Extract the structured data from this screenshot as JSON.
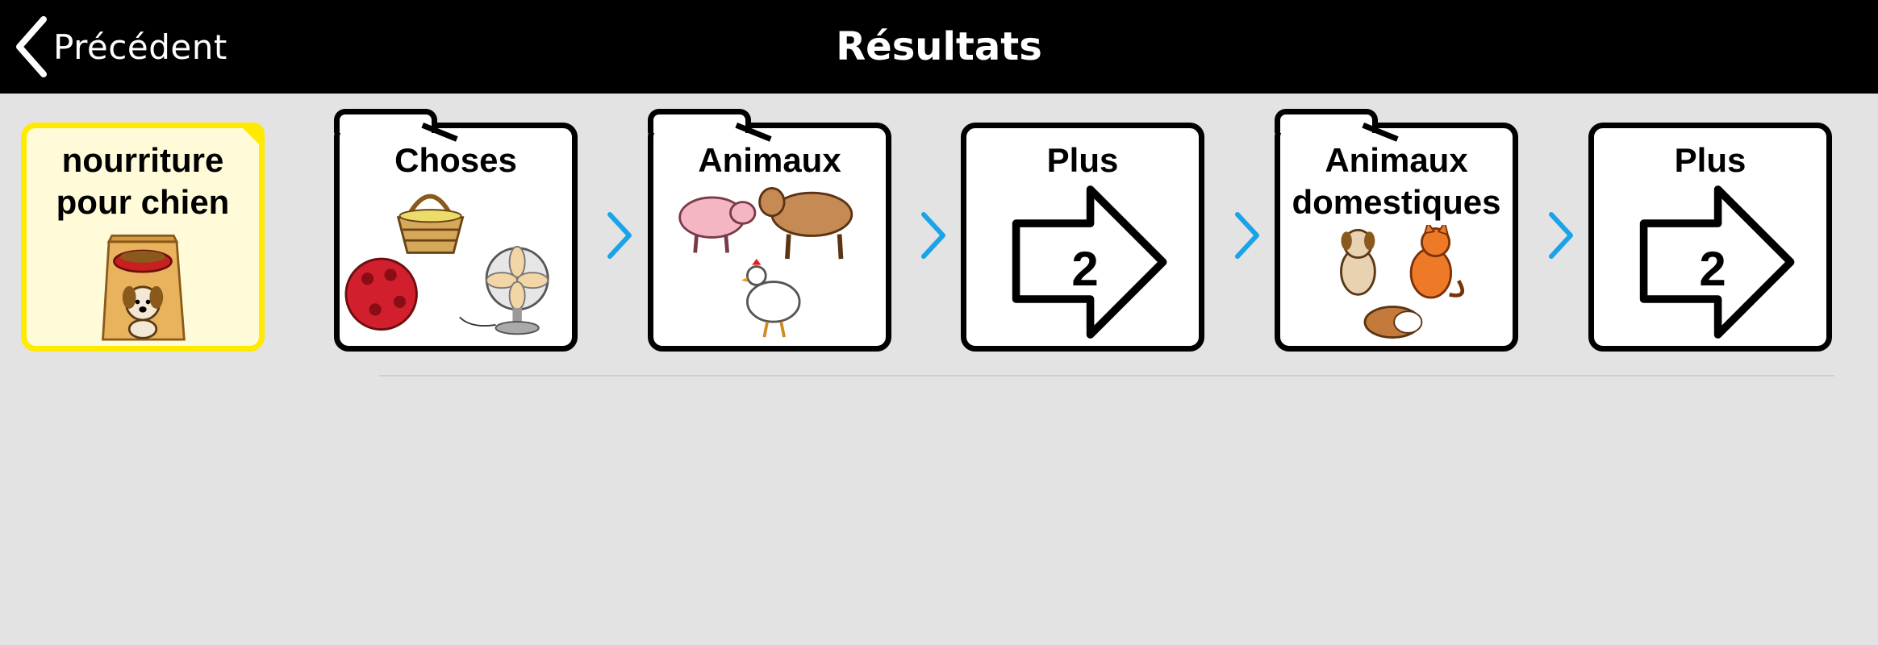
{
  "header": {
    "back_label": "Précédent",
    "title": "Résultats"
  },
  "result_tile": {
    "label": "nourriture pour chien",
    "icon": "dog-food-bag-icon",
    "highlight_color": "#ffea00"
  },
  "path": [
    {
      "label": "Choses",
      "type": "folder",
      "icon": "things-icon"
    },
    {
      "label": "Animaux",
      "type": "folder",
      "icon": "farm-animals-icon"
    },
    {
      "label": "Plus",
      "type": "page",
      "icon": "arrow-right-icon",
      "page_number": "2"
    },
    {
      "label": "Animaux domestiques",
      "type": "folder",
      "icon": "pets-icon"
    },
    {
      "label": "Plus",
      "type": "page",
      "icon": "arrow-right-icon",
      "page_number": "2"
    }
  ],
  "separator": {
    "icon": "chevron-right-icon",
    "color": "#1aa3e8"
  }
}
